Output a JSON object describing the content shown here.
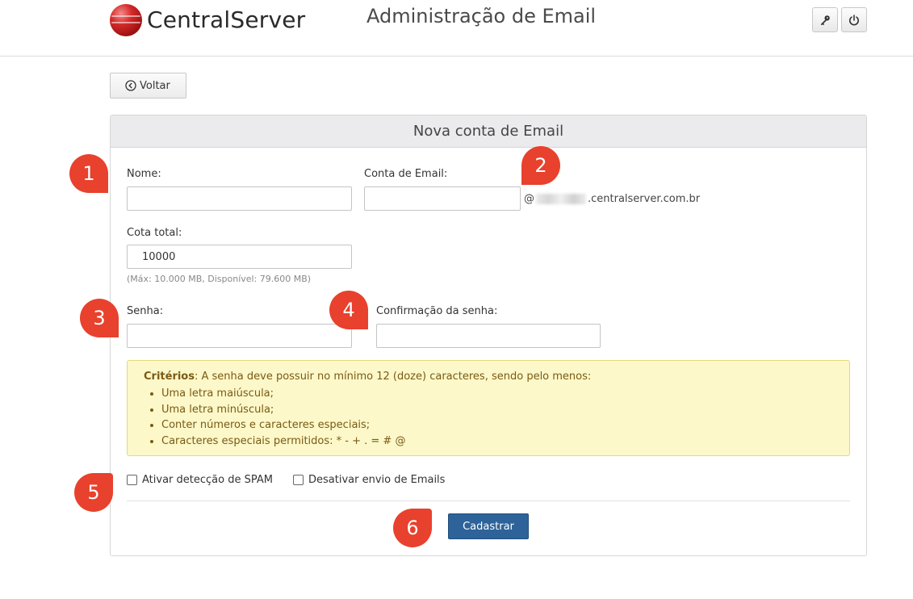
{
  "header": {
    "brand": "CentralServer",
    "title": "Administração de Email",
    "icons": [
      "key-icon",
      "power-icon"
    ]
  },
  "nav": {
    "back_label": "Voltar"
  },
  "form": {
    "heading": "Nova conta de Email",
    "name_label": "Nome:",
    "name_value": "",
    "email_label": "Conta de Email:",
    "email_value": "",
    "domain_prefix": "@",
    "domain_suffix": ".centralserver.com.br",
    "quota_label": "Cota total:",
    "quota_value": "10000",
    "quota_hint": "(Máx: 10.000 MB, Disponível: 79.600 MB)",
    "password_label": "Senha:",
    "password_confirm_label": "Confirmação da senha:",
    "criteria": {
      "title": "Critérios",
      "intro": ": A senha deve possuir no mínimo 12 (doze) caracteres, sendo pelo menos:",
      "items": [
        "Uma letra maiúscula;",
        "Uma letra minúscula;",
        "Conter números e caracteres especiais;",
        "Caracteres especiais permitidos: * - + . = # @"
      ]
    },
    "spam_label": "Ativar detecção de SPAM",
    "disable_send_label": "Desativar envio de Emails",
    "submit_label": "Cadastrar"
  },
  "annotations": [
    "1",
    "2",
    "3",
    "4",
    "5",
    "6"
  ],
  "colors": {
    "accent": "#2d6399",
    "marker": "#e8412d",
    "alert_bg": "#fcf8c9",
    "alert_text": "#7a5a14"
  }
}
